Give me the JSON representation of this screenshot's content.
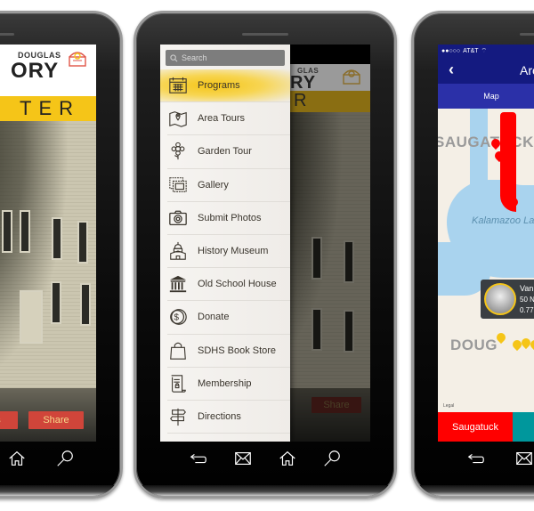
{
  "phone_home": {
    "brand": {
      "top_line": "DOUGLAS",
      "middle_line": "ORY",
      "bottom_line": "TER",
      "logo_icon": "museum-logo-icon"
    },
    "buttons": [
      {
        "label": "ns"
      },
      {
        "label": "Share"
      }
    ],
    "nav_icons": [
      "home-icon",
      "search-icon"
    ]
  },
  "phone_menu": {
    "search": {
      "placeholder": "Search"
    },
    "menu_items": [
      {
        "label": "Programs",
        "icon": "calendar-icon",
        "active": true
      },
      {
        "label": "Area Tours",
        "icon": "map-pin-icon"
      },
      {
        "label": "Garden Tour",
        "icon": "flower-icon"
      },
      {
        "label": "Gallery",
        "icon": "gallery-frames-icon"
      },
      {
        "label": "Submit Photos",
        "icon": "camera-icon"
      },
      {
        "label": "History Museum",
        "icon": "museum-icon"
      },
      {
        "label": "Old School House",
        "icon": "columns-building-icon"
      },
      {
        "label": "Donate",
        "icon": "dollar-coin-icon"
      },
      {
        "label": "SDHS Book Store",
        "icon": "shopping-bag-icon"
      },
      {
        "label": "Membership",
        "icon": "scroll-icon"
      },
      {
        "label": "Directions",
        "icon": "signpost-icon"
      }
    ],
    "background": {
      "brand_top": "GLAS",
      "brand_mid": "RY",
      "brand_bottom": "R",
      "share_label": "Share"
    },
    "nav_icons": [
      "back-icon",
      "mail-icon",
      "home-icon",
      "search-icon"
    ]
  },
  "phone_map": {
    "status": {
      "carrier": "AT&T",
      "signal": "●●○○○"
    },
    "title": "Are",
    "tab": "Map",
    "map": {
      "town_north": "SAUGATUCK",
      "town_south": "DOUG",
      "lake": "Kalamazoo Lake",
      "legal": "Legal"
    },
    "callout": {
      "title": "Van",
      "line2": "50 N",
      "line3": "0.77"
    },
    "bottom_tabs": [
      {
        "label": "Saugatuck",
        "color": "#ff0000"
      },
      {
        "label": "",
        "color": "#00979c"
      }
    ],
    "nav_icons": [
      "back-icon",
      "mail-icon"
    ]
  },
  "colors": {
    "brand_yellow": "#f5c518",
    "share_red": "#d0453a",
    "map_navy": "#141a80",
    "pin_red": "#ff0000",
    "pin_yellow": "#f5c518"
  }
}
